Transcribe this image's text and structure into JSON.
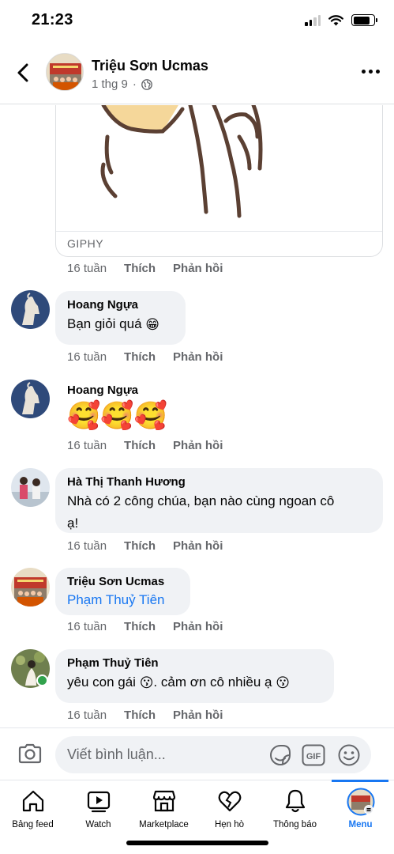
{
  "status_bar": {
    "time": "21:23"
  },
  "header": {
    "title": "Triệu Sơn Ucmas",
    "date": "1 thg 9",
    "separator": "·"
  },
  "gif": {
    "source": "GIPHY"
  },
  "actions": {
    "like": "Thích",
    "reply": "Phản hồi"
  },
  "comments": [
    {
      "time": "16 tuần"
    },
    {
      "name": "Hoang Ngựa",
      "text": "Bạn giỏi quá",
      "emoji": "😁",
      "time": "16 tuần"
    },
    {
      "name": "Hoang Ngựa",
      "emoji": "🥰🥰🥰",
      "time": "16 tuần"
    },
    {
      "name": "Hà Thị Thanh Hương",
      "text_line1": "Nhà có 2 công chúa, bạn nào cùng ngoan cô",
      "text_line2": "ạ!",
      "time": "16 tuần"
    },
    {
      "name": "Triệu Sơn Ucmas",
      "mention": "Phạm Thuỷ Tiên",
      "time": "16 tuần"
    },
    {
      "name": "Phạm Thuỷ Tiên",
      "text_a": "yêu con gái",
      "text_b": ". cảm ơn cô nhiều ạ",
      "emoji": "😗",
      "time": "16 tuần"
    }
  ],
  "composer": {
    "placeholder": "Viết bình luận...",
    "gif_label": "GIF"
  },
  "tabs": [
    {
      "label": "Bảng feed",
      "icon": "home-icon"
    },
    {
      "label": "Watch",
      "icon": "watch-icon"
    },
    {
      "label": "Marketplace",
      "icon": "marketplace-icon"
    },
    {
      "label": "Hẹn hò",
      "icon": "dating-heart-icon"
    },
    {
      "label": "Thông báo",
      "icon": "bell-icon"
    },
    {
      "label": "Menu",
      "icon": "profile-avatar-icon",
      "active": true
    }
  ],
  "colors": {
    "accent": "#1877f2",
    "bubble": "#f0f2f5",
    "muted": "#65676b",
    "online": "#31a24c"
  }
}
